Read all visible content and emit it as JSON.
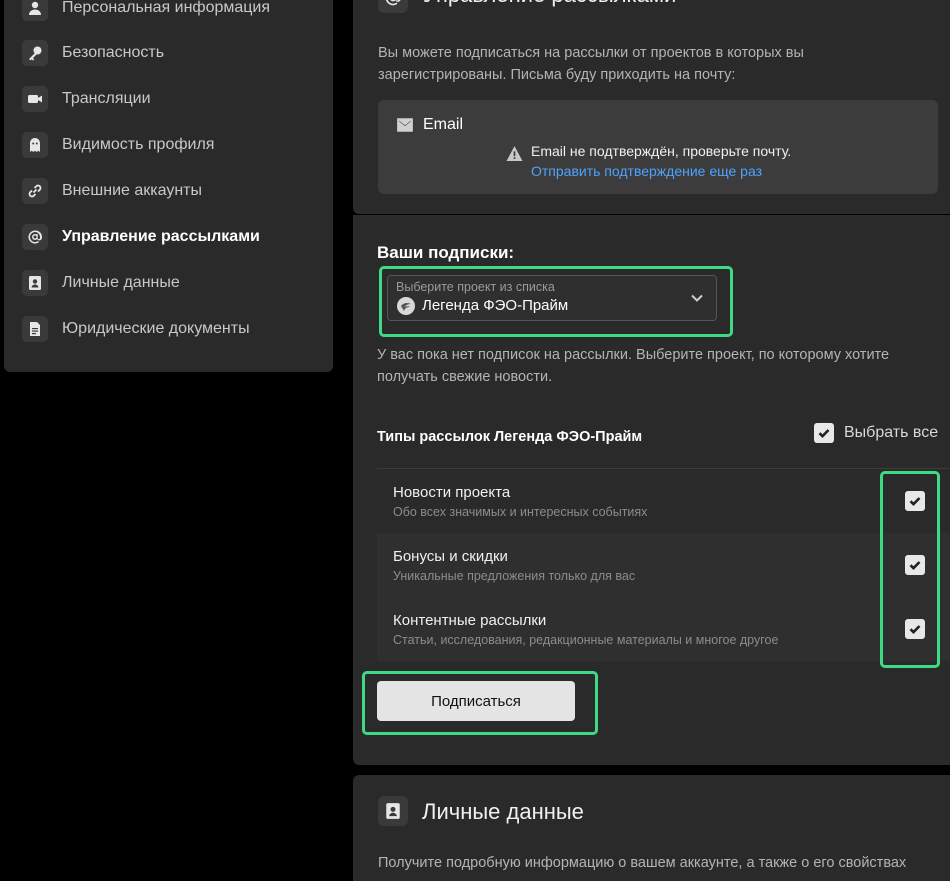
{
  "sidebar": {
    "items": [
      {
        "label": "Персональная информация",
        "icon": "user-icon"
      },
      {
        "label": "Безопасность",
        "icon": "key-icon"
      },
      {
        "label": "Трансляции",
        "icon": "camera-icon"
      },
      {
        "label": "Видимость профиля",
        "icon": "ghost-icon"
      },
      {
        "label": "Внешние аккаунты",
        "icon": "link-icon"
      },
      {
        "label": "Управление рассылками",
        "icon": "at-icon",
        "active": true
      },
      {
        "label": "Личные данные",
        "icon": "contact-card-icon"
      },
      {
        "label": "Юридические документы",
        "icon": "document-icon"
      }
    ]
  },
  "mailing": {
    "title": "Управление рассылками",
    "description": "Вы можете подписаться на рассылки от проектов в которых вы зарегистрированы. Письма буду приходить на почту:",
    "email_label": "Email",
    "warning": "Email не подтверждён, проверьте почту.",
    "resend_link": "Отправить подтверждение еще раз"
  },
  "subscriptions": {
    "title": "Ваши подписки:",
    "select": {
      "placeholder": "Выберите проект из списка",
      "value": "Легенда ФЭО-Прайм"
    },
    "empty_text": "У вас пока нет подписок на рассылки. Выберите проект, по которому хотите получать свежие новости.",
    "types_title": "Типы рассылок Легенда ФЭО-Прайм",
    "select_all": "Выбрать все",
    "types": [
      {
        "name": "Новости проекта",
        "description": "Обо всех значимых и интересных событиях",
        "checked": true
      },
      {
        "name": "Бонусы и скидки",
        "description": "Уникальные предложения только для вас",
        "checked": true
      },
      {
        "name": "Контентные рассылки",
        "description": "Статьи, исследования, редакционные материалы и многое другое",
        "checked": true
      }
    ],
    "subscribe_button": "Подписаться"
  },
  "personal_data": {
    "title": "Личные данные",
    "description": "Получите подробную информацию о вашем аккаунте, а также о его свойствах"
  },
  "colors": {
    "highlight": "#3ddc84",
    "link": "#4ea3ff",
    "panel": "#2a2a2a",
    "background": "#000000"
  }
}
